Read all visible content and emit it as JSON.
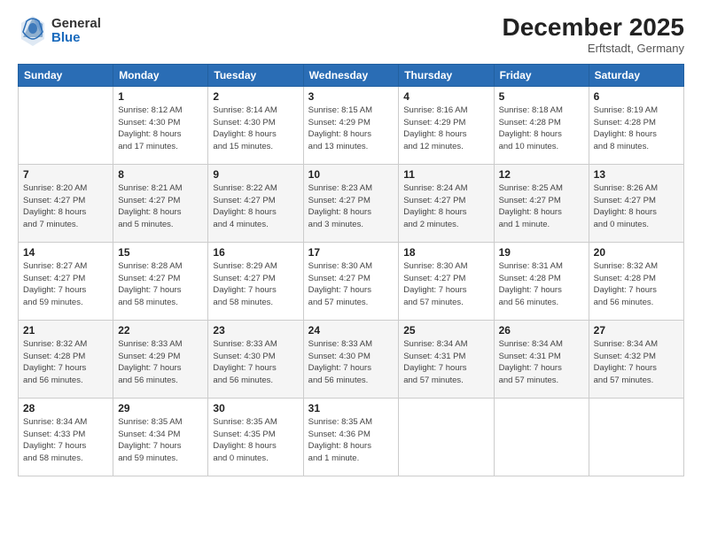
{
  "header": {
    "logo_line1": "General",
    "logo_line2": "Blue",
    "month": "December 2025",
    "location": "Erftstadt, Germany"
  },
  "columns": [
    "Sunday",
    "Monday",
    "Tuesday",
    "Wednesday",
    "Thursday",
    "Friday",
    "Saturday"
  ],
  "weeks": [
    [
      {
        "day": "",
        "info": ""
      },
      {
        "day": "1",
        "info": "Sunrise: 8:12 AM\nSunset: 4:30 PM\nDaylight: 8 hours\nand 17 minutes."
      },
      {
        "day": "2",
        "info": "Sunrise: 8:14 AM\nSunset: 4:30 PM\nDaylight: 8 hours\nand 15 minutes."
      },
      {
        "day": "3",
        "info": "Sunrise: 8:15 AM\nSunset: 4:29 PM\nDaylight: 8 hours\nand 13 minutes."
      },
      {
        "day": "4",
        "info": "Sunrise: 8:16 AM\nSunset: 4:29 PM\nDaylight: 8 hours\nand 12 minutes."
      },
      {
        "day": "5",
        "info": "Sunrise: 8:18 AM\nSunset: 4:28 PM\nDaylight: 8 hours\nand 10 minutes."
      },
      {
        "day": "6",
        "info": "Sunrise: 8:19 AM\nSunset: 4:28 PM\nDaylight: 8 hours\nand 8 minutes."
      }
    ],
    [
      {
        "day": "7",
        "info": "Sunrise: 8:20 AM\nSunset: 4:27 PM\nDaylight: 8 hours\nand 7 minutes."
      },
      {
        "day": "8",
        "info": "Sunrise: 8:21 AM\nSunset: 4:27 PM\nDaylight: 8 hours\nand 5 minutes."
      },
      {
        "day": "9",
        "info": "Sunrise: 8:22 AM\nSunset: 4:27 PM\nDaylight: 8 hours\nand 4 minutes."
      },
      {
        "day": "10",
        "info": "Sunrise: 8:23 AM\nSunset: 4:27 PM\nDaylight: 8 hours\nand 3 minutes."
      },
      {
        "day": "11",
        "info": "Sunrise: 8:24 AM\nSunset: 4:27 PM\nDaylight: 8 hours\nand 2 minutes."
      },
      {
        "day": "12",
        "info": "Sunrise: 8:25 AM\nSunset: 4:27 PM\nDaylight: 8 hours\nand 1 minute."
      },
      {
        "day": "13",
        "info": "Sunrise: 8:26 AM\nSunset: 4:27 PM\nDaylight: 8 hours\nand 0 minutes."
      }
    ],
    [
      {
        "day": "14",
        "info": "Sunrise: 8:27 AM\nSunset: 4:27 PM\nDaylight: 7 hours\nand 59 minutes."
      },
      {
        "day": "15",
        "info": "Sunrise: 8:28 AM\nSunset: 4:27 PM\nDaylight: 7 hours\nand 58 minutes."
      },
      {
        "day": "16",
        "info": "Sunrise: 8:29 AM\nSunset: 4:27 PM\nDaylight: 7 hours\nand 58 minutes."
      },
      {
        "day": "17",
        "info": "Sunrise: 8:30 AM\nSunset: 4:27 PM\nDaylight: 7 hours\nand 57 minutes."
      },
      {
        "day": "18",
        "info": "Sunrise: 8:30 AM\nSunset: 4:27 PM\nDaylight: 7 hours\nand 57 minutes."
      },
      {
        "day": "19",
        "info": "Sunrise: 8:31 AM\nSunset: 4:28 PM\nDaylight: 7 hours\nand 56 minutes."
      },
      {
        "day": "20",
        "info": "Sunrise: 8:32 AM\nSunset: 4:28 PM\nDaylight: 7 hours\nand 56 minutes."
      }
    ],
    [
      {
        "day": "21",
        "info": "Sunrise: 8:32 AM\nSunset: 4:28 PM\nDaylight: 7 hours\nand 56 minutes."
      },
      {
        "day": "22",
        "info": "Sunrise: 8:33 AM\nSunset: 4:29 PM\nDaylight: 7 hours\nand 56 minutes."
      },
      {
        "day": "23",
        "info": "Sunrise: 8:33 AM\nSunset: 4:30 PM\nDaylight: 7 hours\nand 56 minutes."
      },
      {
        "day": "24",
        "info": "Sunrise: 8:33 AM\nSunset: 4:30 PM\nDaylight: 7 hours\nand 56 minutes."
      },
      {
        "day": "25",
        "info": "Sunrise: 8:34 AM\nSunset: 4:31 PM\nDaylight: 7 hours\nand 57 minutes."
      },
      {
        "day": "26",
        "info": "Sunrise: 8:34 AM\nSunset: 4:31 PM\nDaylight: 7 hours\nand 57 minutes."
      },
      {
        "day": "27",
        "info": "Sunrise: 8:34 AM\nSunset: 4:32 PM\nDaylight: 7 hours\nand 57 minutes."
      }
    ],
    [
      {
        "day": "28",
        "info": "Sunrise: 8:34 AM\nSunset: 4:33 PM\nDaylight: 7 hours\nand 58 minutes."
      },
      {
        "day": "29",
        "info": "Sunrise: 8:35 AM\nSunset: 4:34 PM\nDaylight: 7 hours\nand 59 minutes."
      },
      {
        "day": "30",
        "info": "Sunrise: 8:35 AM\nSunset: 4:35 PM\nDaylight: 8 hours\nand 0 minutes."
      },
      {
        "day": "31",
        "info": "Sunrise: 8:35 AM\nSunset: 4:36 PM\nDaylight: 8 hours\nand 1 minute."
      },
      {
        "day": "",
        "info": ""
      },
      {
        "day": "",
        "info": ""
      },
      {
        "day": "",
        "info": ""
      }
    ]
  ]
}
